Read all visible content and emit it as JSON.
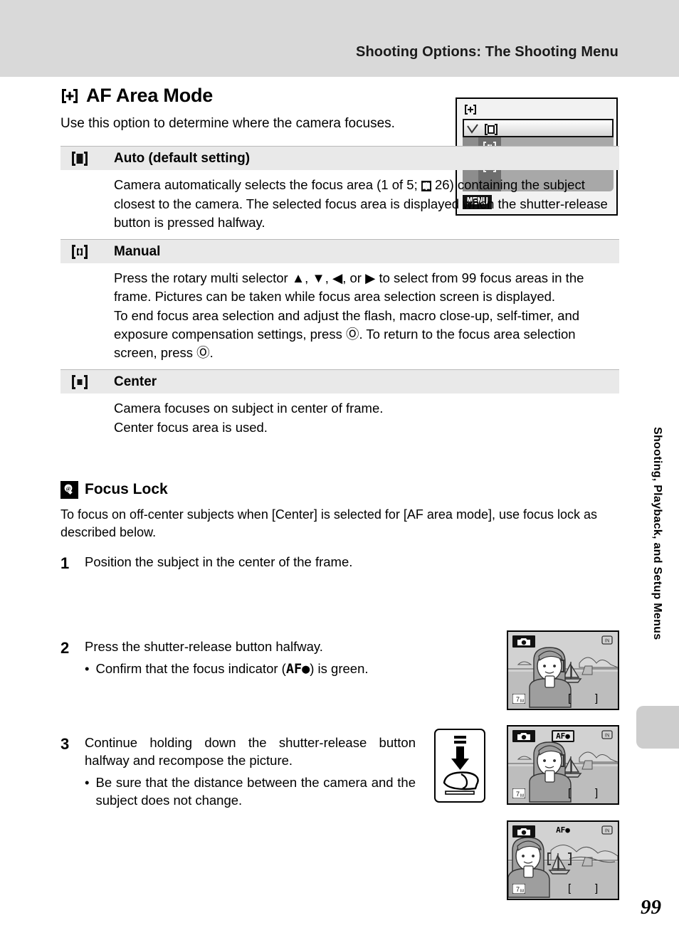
{
  "header": {
    "title": "Shooting Options: The Shooting Menu"
  },
  "section": {
    "icon": "af-area-bracket-icon",
    "title": "AF Area Mode",
    "intro": "Use this option to determine where the camera focuses."
  },
  "lcd_menu": {
    "tab_icon": "af-area-bracket-icon",
    "menu_button_label": "MENU",
    "rows": [
      {
        "icon": "focus-area-auto-icon",
        "selected": true,
        "check": "✓"
      },
      {
        "icon": "focus-area-manual-icon",
        "selected": false,
        "check": ""
      },
      {
        "icon": "focus-area-center-icon",
        "selected": false,
        "check": ""
      }
    ]
  },
  "options": [
    {
      "icon": "focus-area-auto-icon",
      "label": "Auto (default setting)",
      "body_parts": [
        "Camera automatically selects the focus area (1 of 5; ",
        " 26) containing the subject closest to the camera. The selected focus area is displayed when the shutter-release button is pressed halfway."
      ],
      "inline_icon": "reference-book-icon"
    },
    {
      "icon": "focus-area-manual-icon",
      "label": "Manual",
      "paragraphs": [
        "Press the rotary multi selector ▲, ▼, ◀, or ▶  to select from 99 focus areas in the frame. Pictures can be taken while focus area selection screen is displayed.",
        "To end focus area selection and adjust the flash, macro close-up, self-timer, and exposure compensation settings, press Ⓞ. To return to the focus area selection screen, press Ⓞ."
      ]
    },
    {
      "icon": "focus-area-center-icon",
      "label": "Center",
      "paragraphs": [
        "Camera focuses on subject in center of frame.",
        "Center focus area is used."
      ]
    }
  ],
  "tip": {
    "badge_icon": "lightbulb-tip-icon",
    "title": "Focus Lock",
    "intro": "To focus on off-center subjects when [Center] is selected for [AF area mode], use focus lock as described below."
  },
  "steps": [
    {
      "num": "1",
      "text": "Position the subject in the center of the frame.",
      "bullets": []
    },
    {
      "num": "2",
      "text": "Press the shutter-release button halfway.",
      "bullets": [
        {
          "pre": "Confirm that the focus indicator (",
          "code": "AF●",
          "post": ") is green."
        }
      ]
    },
    {
      "num": "3",
      "text": "Continue holding down the shutter-release button halfway and recompose the picture.",
      "bullets": [
        {
          "pre": "Be sure that the distance between the camera and the subject does not change.",
          "code": "",
          "post": ""
        }
      ]
    }
  ],
  "shots": [
    {
      "rec_icon": "record-mode-icon",
      "in_badge": "IN",
      "mp_badge": "7M",
      "af_badge": "",
      "af_style": "none"
    },
    {
      "rec_icon": "record-mode-icon",
      "in_badge": "IN",
      "mp_badge": "7M",
      "af_badge": "AF●",
      "af_style": "boxed"
    },
    {
      "rec_icon": "record-mode-icon",
      "in_badge": "IN",
      "mp_badge": "7M",
      "af_badge": "AF●",
      "af_style": "plain"
    }
  ],
  "sidebar": {
    "vertical_label": "Shooting, Playback, and Setup Menus"
  },
  "footer": {
    "page_number": "99"
  },
  "colors": {
    "header_band": "#d9d9d9",
    "row_header": "#e9e9e9",
    "lcd_body": "#a8a8a8",
    "tab_block": "#cdcdcd"
  }
}
